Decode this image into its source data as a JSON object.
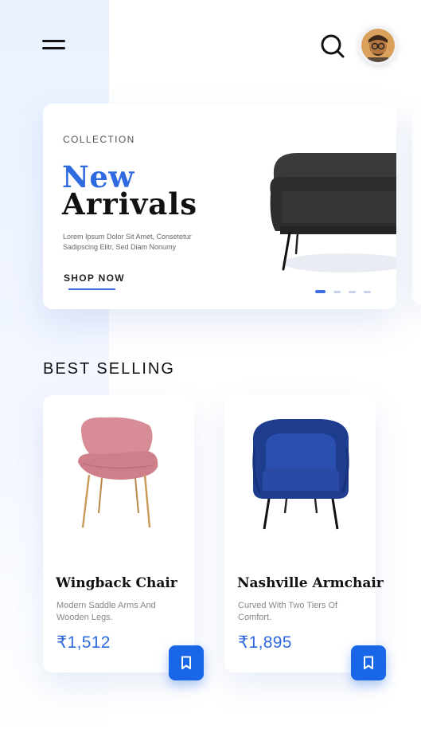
{
  "header": {
    "menu_icon": "hamburger-menu-icon",
    "search_icon": "search-icon",
    "avatar_icon": "user-avatar"
  },
  "hero": {
    "eyebrow": "COLLECTION",
    "title_line1": "New",
    "title_line2": "Arrivals",
    "description": "Lorem Ipsum Dolor Sit Amet, Consetetur Sadipscing Elitr, Sed Diam Nonumy",
    "cta_label": "SHOP NOW",
    "slides_count": 4,
    "active_slide": 1
  },
  "best_selling": {
    "title": "BEST SELLING",
    "products": [
      {
        "name": "Wingback Chair",
        "description": "Modern Saddle Arms And Wooden Legs.",
        "price": "₹1,512",
        "bookmark_icon": "bookmark-icon"
      },
      {
        "name": "Nashville Armchair",
        "description": "Curved With Two Tiers Of Comfort.",
        "price": "₹1,895",
        "bookmark_icon": "bookmark-icon"
      }
    ]
  },
  "colors": {
    "accent": "#2f6ae0",
    "button_blue": "#1a66e8",
    "text_dark": "#111111",
    "muted": "#888888",
    "bg_tint": "#eaf2ff"
  }
}
